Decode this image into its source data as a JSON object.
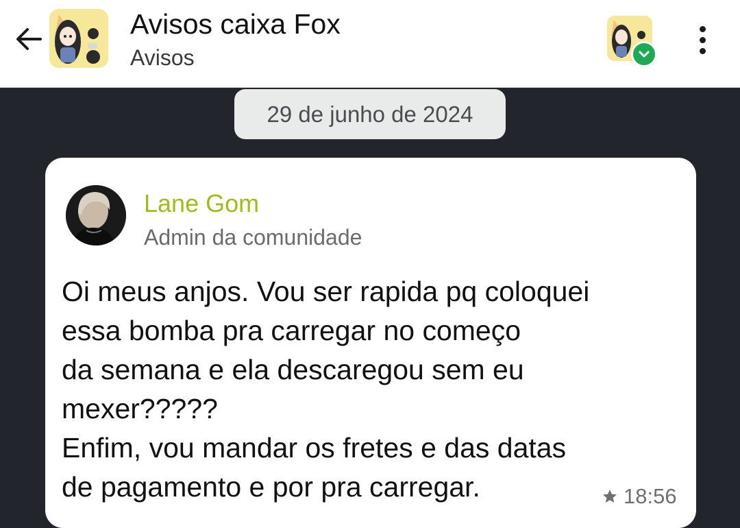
{
  "header": {
    "title": "Avisos caixa Fox",
    "subtitle": "Avisos",
    "back_icon": "arrow-left-icon",
    "menu_icon": "more-vertical-icon",
    "verified_icon": "check-badge-icon"
  },
  "date_separator": "29 de junho de 2024",
  "message": {
    "sender_name": "Lane Gom",
    "sender_role": "Admin da comunidade",
    "lines": [
      "Oi meus anjos. Vou ser rapida pq coloquei",
      "essa bomba pra carregar no começo",
      "da semana e ela descaregou sem eu",
      "mexer?????",
      "Enfim, vou mandar os fretes e das datas",
      "de pagamento e por pra carregar."
    ],
    "time": "18:56",
    "starred_icon": "star-icon"
  },
  "colors": {
    "chat_background": "#22262c",
    "sender_name": "#a4b81f",
    "verified_badge": "#1fa855",
    "avatar_background": "#f6e79a"
  }
}
